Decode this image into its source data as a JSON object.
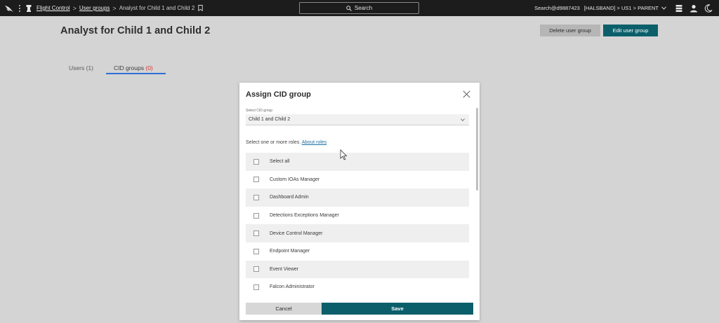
{
  "topbar": {
    "breadcrumb": {
      "root": "Flight Control",
      "parent": "User groups",
      "current": "Analyst for Child 1 and Child 2",
      "separator": ">"
    },
    "search_label": "Search",
    "account": "Search@d9887423",
    "cid_path": "[HALSBAND] > US1 > PARENT",
    "icons": [
      "falcon-logo",
      "kebab-menu-icon",
      "chess-icon",
      "bookmark-icon",
      "search-icon",
      "chevron-down-icon",
      "notifications-icon",
      "user-icon",
      "moon-icon"
    ]
  },
  "page": {
    "title": "Analyst for Child 1 and Child 2",
    "delete_button": "Delete user group",
    "edit_button": "Edit user group",
    "tabs": [
      {
        "label": "Users",
        "count": "(1)"
      },
      {
        "label": "CID groups",
        "count": "(0)",
        "active": true
      }
    ]
  },
  "modal": {
    "title": "Assign CID group",
    "select_label": "Select CID group",
    "select_value": "Child 1 and Child 2",
    "roles_prompt": "Select one or more roles.",
    "about_roles_link": "About roles",
    "roles": [
      {
        "label": "Select all",
        "checked": false
      },
      {
        "label": "Custom IOAs Manager",
        "checked": false
      },
      {
        "label": "Dashboard Admin",
        "checked": false
      },
      {
        "label": "Detections Exceptions Manager",
        "checked": false
      },
      {
        "label": "Device Control Manager",
        "checked": false
      },
      {
        "label": "Endpoint Manager",
        "checked": false
      },
      {
        "label": "Event Viewer",
        "checked": false
      },
      {
        "label": "Falcon Administrator",
        "checked": false
      }
    ],
    "cancel_button": "Cancel",
    "save_button": "Save"
  },
  "colors": {
    "primary": "#0b5f6b",
    "topbar": "#1c1c1c",
    "tab_active_underline": "#2f6fd6",
    "count_zero": "#d63a3a",
    "link": "#1a6fa0"
  }
}
